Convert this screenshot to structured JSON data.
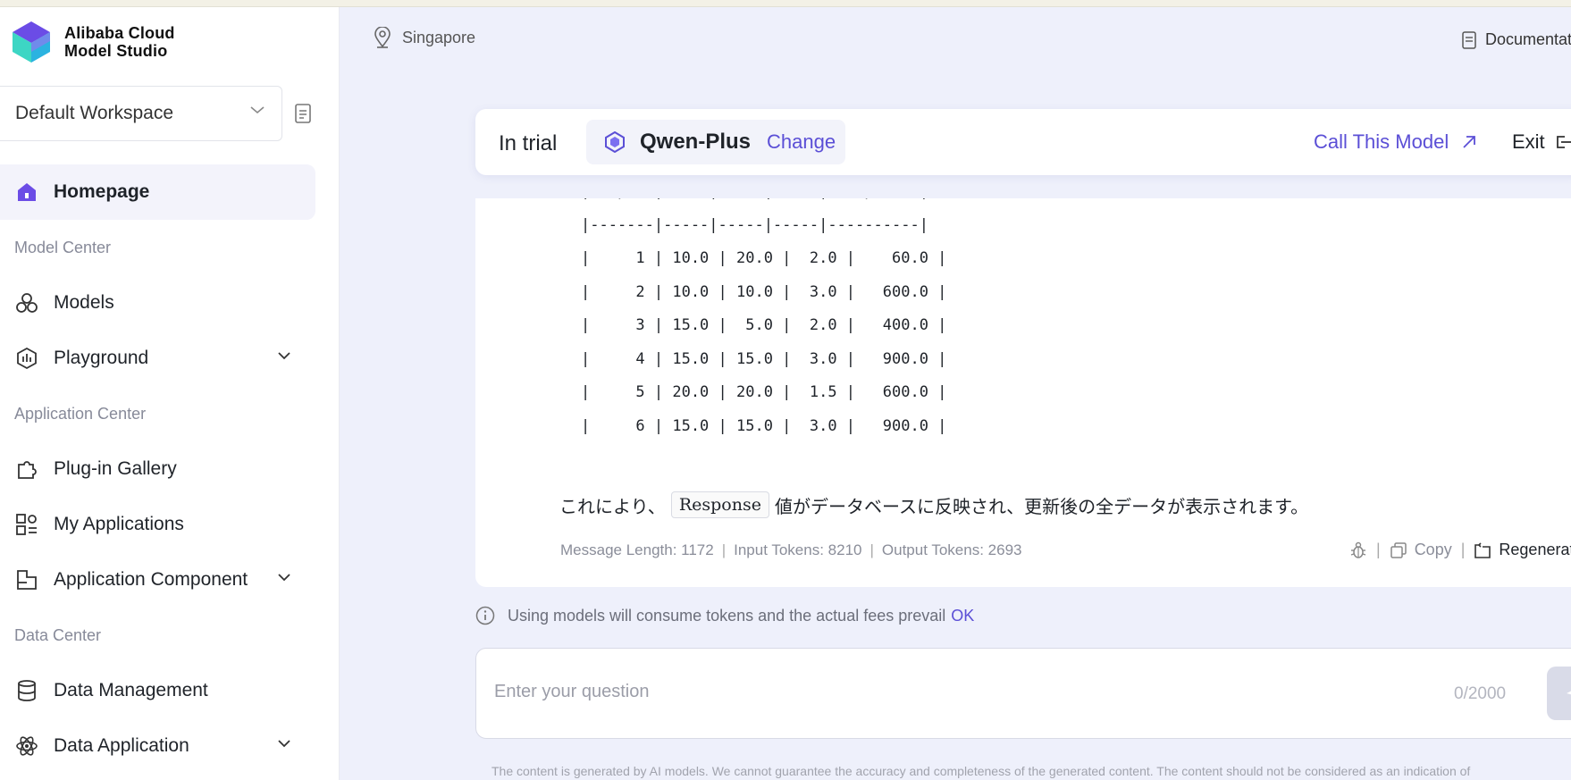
{
  "brand": {
    "line1": "Alibaba Cloud",
    "line2": "Model Studio"
  },
  "workspace": {
    "label": "Default Workspace"
  },
  "nav": {
    "homepage": "Homepage",
    "section_model": "Model Center",
    "models": "Models",
    "playground": "Playground",
    "section_app": "Application Center",
    "plugin": "Plug-in Gallery",
    "myapps": "My Applications",
    "appcomp": "Application Component",
    "section_data": "Data Center",
    "datamgmt": "Data Management",
    "dataapp": "Data Application"
  },
  "header": {
    "region": "Singapore",
    "docs": "Documentation"
  },
  "modelbar": {
    "status": "In trial",
    "model_name": "Qwen-Plus",
    "change": "Change",
    "call": "Call This Model",
    "exit": "Exit"
  },
  "table": {
    "rows": [
      "| ExpNo |  A  |  B  |  C  | Response |",
      "|-------|-----|-----|-----|----------|",
      "|     1 | 10.0 | 20.0 |  2.0 |    60.0 |",
      "|     2 | 10.0 | 10.0 |  3.0 |   600.0 |",
      "|     3 | 15.0 |  5.0 |  2.0 |   400.0 |",
      "|     4 | 15.0 | 15.0 |  3.0 |   900.0 |",
      "|     5 | 20.0 | 20.0 |  1.5 |   600.0 |",
      "|     6 | 15.0 | 15.0 |  3.0 |   900.0 |"
    ]
  },
  "message": {
    "jp_before": "これにより、",
    "code": "Response",
    "jp_after": "値がデータベースに反映され、更新後の全データが表示されます。",
    "length": "Message Length: 1172",
    "input_tokens": "Input Tokens: 8210",
    "output_tokens": "Output Tokens: 2693",
    "copy": "Copy",
    "regenerate": "Regenerate"
  },
  "notice": {
    "text": "Using models will consume tokens and the actual fees prevail",
    "ok": "OK"
  },
  "input": {
    "placeholder": "Enter your question",
    "counter": "0/2000"
  },
  "disclaimer": "The content is generated by AI models. We cannot guarantee the accuracy and completeness of the generated content. The content should not be considered as an indication of",
  "colors": {
    "accent": "#5b4fd6",
    "background": "#eef0fb"
  },
  "icons": [
    "location-icon",
    "doc-icon",
    "home-icon",
    "models-icon",
    "playground-icon",
    "plugin-icon",
    "apps-icon",
    "component-icon",
    "database-icon",
    "atom-icon",
    "model-logo-icon",
    "arrow-up-right-icon",
    "exit-icon",
    "bug-icon",
    "copy-icon",
    "regenerate-icon",
    "info-icon",
    "send-icon"
  ]
}
